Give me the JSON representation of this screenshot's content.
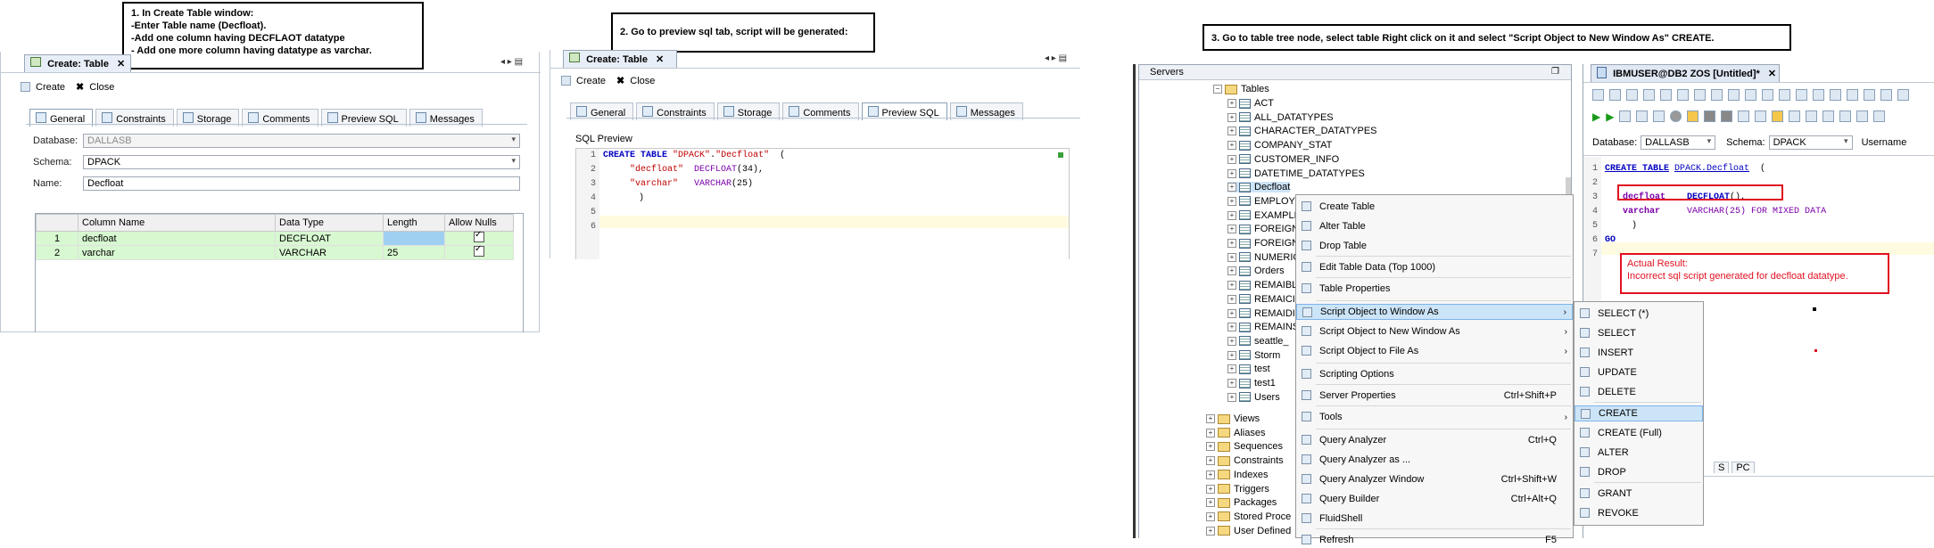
{
  "notes": {
    "step1": [
      "1. In Create Table window:",
      "-Enter Table name (Decfloat).",
      "-Add one column having DECFLAOT datatype",
      "- Add one more column having datatype as varchar."
    ],
    "step2": "2. Go to preview sql tab, script will be generated:",
    "step3": "3. Go to table tree node, select table  Right click on it and select \"Script Object to New Window As\" CREATE."
  },
  "panel1": {
    "tab_title": "Create: Table",
    "toolbar": {
      "create": "Create",
      "close": "Close"
    },
    "tabs": [
      "General",
      "Constraints",
      "Storage",
      "Comments",
      "Preview SQL",
      "Messages"
    ],
    "active_tab": "General",
    "form": {
      "database_label": "Database:",
      "database_value": "DALLASB",
      "schema_label": "Schema:",
      "schema_value": "DPACK",
      "name_label": "Name:",
      "name_value": "Decfloat"
    },
    "columns_headers": [
      "",
      "Column Name",
      "Data Type",
      "Length",
      "Allow Nulls"
    ],
    "rows": [
      {
        "num": "1",
        "name": "decfloat",
        "type": "DECFLOAT",
        "length": ""
      },
      {
        "num": "2",
        "name": "varchar",
        "type": "VARCHAR",
        "length": "25"
      }
    ]
  },
  "panel2": {
    "tab_title": "Create: Table",
    "toolbar": {
      "create": "Create",
      "close": "Close"
    },
    "tabs": [
      "General",
      "Constraints",
      "Storage",
      "Comments",
      "Preview SQL",
      "Messages"
    ],
    "active_tab": "Preview SQL",
    "preview_label": "SQL Preview",
    "line_numbers": [
      "1",
      "2",
      "3",
      "4",
      "5",
      "6"
    ],
    "code": {
      "l1_kw": "CREATE TABLE",
      "l1_s1": "\"DPACK\"",
      "l1_dot": ".",
      "l1_s2": "\"Decfloat\"",
      "l1_paren": "  (",
      "l2_s": "\"decfloat\"",
      "l2_t": "DECFLOAT",
      "l2_rest": "(34),",
      "l3_s": "\"varchar\"",
      "l3_t": "VARCHAR",
      "l3_rest": "(25)",
      "l4": ")"
    }
  },
  "panel3": {
    "servers_title": "Servers",
    "tree": {
      "tables": "Tables",
      "items": [
        "ACT",
        "ALL_DATATYPES",
        "CHARACTER_DATATYPES",
        "COMPANY_STAT",
        "CUSTOMER_INFO",
        "DATETIME_DATATYPES",
        "Decfloat",
        "EMPLOYE",
        "EXAMPLE",
        "FOREIGN",
        "FOREIGN",
        "NUMERIC",
        "Orders",
        "REMAIBL",
        "REMAICI",
        "REMAIDI",
        "REMAINS",
        "seattle_",
        "Storm",
        "test",
        "test1",
        "Users"
      ],
      "folders": [
        "Views",
        "Aliases",
        "Sequences",
        "Constraints",
        "Indexes",
        "Triggers",
        "Packages",
        "Stored Proce",
        "User Defined"
      ]
    },
    "editor": {
      "tab_title": "IBMUSER@DB2 ZOS [Untitled]*",
      "database_label": "Database:",
      "database_value": "DALLASB",
      "schema_label": "Schema:",
      "schema_value": "DPACK",
      "username_label": "Username",
      "line_numbers": [
        "1",
        "2",
        "3",
        "4",
        "5",
        "6",
        "7"
      ],
      "l1_kw": "CREATE TABLE",
      "l1_obj": "DPACK.Decfloat",
      "l1_paren": "  (",
      "l3_name": "decfloat",
      "l3_type": "DECFLOAT",
      "l3_rest": "(),",
      "l4_name": "varchar",
      "l4_type": "VARCHAR",
      "l4_rest": "(25) FOR MIXED DATA",
      "l5": ")",
      "l6": "GO"
    },
    "result": {
      "title": "Actual Result:",
      "text": "Incorrect sql script generated for decfloat datatype."
    },
    "bottom_tabs": [
      "S",
      "PC"
    ],
    "context_menu": [
      {
        "label": "Create Table",
        "shortcut": "",
        "arrow": false
      },
      {
        "label": "Alter Table",
        "shortcut": "",
        "arrow": false
      },
      {
        "label": "Drop Table",
        "shortcut": "",
        "arrow": false
      },
      {
        "label": "Edit Table Data (Top 1000)",
        "shortcut": "",
        "arrow": false
      },
      {
        "label": "Table Properties",
        "shortcut": "",
        "arrow": false
      },
      {
        "label": "Script Object to Window As",
        "shortcut": "",
        "arrow": true
      },
      {
        "label": "Script Object to New Window As",
        "shortcut": "",
        "arrow": true
      },
      {
        "label": "Script Object to File As",
        "shortcut": "",
        "arrow": true
      },
      {
        "label": "Scripting Options",
        "shortcut": "",
        "arrow": false
      },
      {
        "label": "Server Properties",
        "shortcut": "Ctrl+Shift+P",
        "arrow": false
      },
      {
        "label": "Tools",
        "shortcut": "",
        "arrow": true
      },
      {
        "label": "Query Analyzer",
        "shortcut": "Ctrl+Q",
        "arrow": false
      },
      {
        "label": "Query Analyzer as ...",
        "shortcut": "",
        "arrow": false
      },
      {
        "label": "Query Analyzer Window",
        "shortcut": "Ctrl+Shift+W",
        "arrow": false
      },
      {
        "label": "Query Builder",
        "shortcut": "Ctrl+Alt+Q",
        "arrow": false
      },
      {
        "label": "FluidShell",
        "shortcut": "",
        "arrow": false
      },
      {
        "label": "Refresh",
        "shortcut": "F5",
        "arrow": false
      }
    ],
    "submenu": [
      "SELECT (*)",
      "SELECT",
      "INSERT",
      "UPDATE",
      "DELETE",
      "CREATE",
      "CREATE (Full)",
      "ALTER",
      "DROP",
      "GRANT",
      "REVOKE"
    ]
  }
}
